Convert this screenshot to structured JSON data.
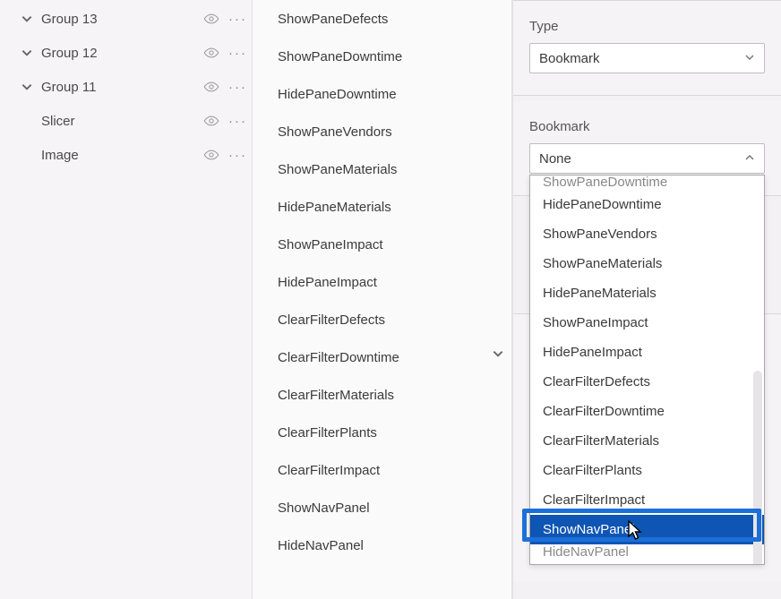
{
  "structure": {
    "rows": [
      {
        "kind": "group",
        "label": "Group 13"
      },
      {
        "kind": "group",
        "label": "Group 12"
      },
      {
        "kind": "group",
        "label": "Group 11"
      },
      {
        "kind": "leaf",
        "label": "Slicer"
      },
      {
        "kind": "leaf",
        "label": "Image"
      }
    ]
  },
  "middle": {
    "items": [
      "ShowPaneDefects",
      "ShowPaneDowntime",
      "HidePaneDowntime",
      "ShowPaneVendors",
      "ShowPaneMaterials",
      "HidePaneMaterials",
      "ShowPaneImpact",
      "HidePaneImpact",
      "ClearFilterDefects",
      "ClearFilterDowntime",
      "ClearFilterMaterials",
      "ClearFilterPlants",
      "ClearFilterImpact",
      "ShowNavPanel",
      "HideNavPanel"
    ]
  },
  "right": {
    "type_label": "Type",
    "type_value": "Bookmark",
    "bookmark_label": "Bookmark",
    "bookmark_value": "None",
    "dropdown": {
      "cutoff_top": "ShowPaneDowntime",
      "items": [
        "HidePaneDowntime",
        "ShowPaneVendors",
        "ShowPaneMaterials",
        "HidePaneMaterials",
        "ShowPaneImpact",
        "HidePaneImpact",
        "ClearFilterDefects",
        "ClearFilterDowntime",
        "ClearFilterMaterials",
        "ClearFilterPlants",
        "ClearFilterImpact",
        "ShowNavPanel",
        "HideNavPanel"
      ],
      "selected_index": 11
    }
  }
}
